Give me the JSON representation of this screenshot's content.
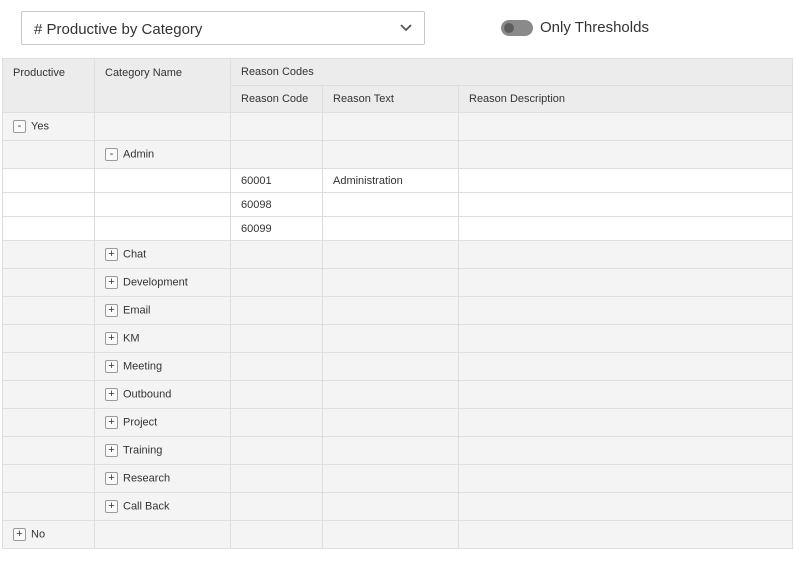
{
  "header": {
    "select_value": "# Productive by Category",
    "toggle_label": "Only Thresholds",
    "toggle_on": false
  },
  "table": {
    "columns": {
      "productive": "Productive",
      "category_name": "Category Name",
      "reason_codes_group": "Reason Codes",
      "reason_code": "Reason Code",
      "reason_text": "Reason Text",
      "reason_description": "Reason Description"
    },
    "rows": {
      "yes": {
        "toggle": "-",
        "label": "Yes"
      },
      "admin": {
        "toggle": "-",
        "label": "Admin"
      },
      "code1": {
        "code": "60001",
        "text": "Administration",
        "desc": ""
      },
      "code2": {
        "code": "60098",
        "text": "",
        "desc": ""
      },
      "code3": {
        "code": "60099",
        "text": "",
        "desc": ""
      },
      "chat": {
        "toggle": "+",
        "label": "Chat"
      },
      "development": {
        "toggle": "+",
        "label": "Development"
      },
      "email": {
        "toggle": "+",
        "label": "Email"
      },
      "km": {
        "toggle": "+",
        "label": "KM"
      },
      "meeting": {
        "toggle": "+",
        "label": "Meeting"
      },
      "outbound": {
        "toggle": "+",
        "label": "Outbound"
      },
      "project": {
        "toggle": "+",
        "label": "Project"
      },
      "training": {
        "toggle": "+",
        "label": "Training"
      },
      "research": {
        "toggle": "+",
        "label": "Research"
      },
      "callback": {
        "toggle": "+",
        "label": "Call Back"
      },
      "no": {
        "toggle": "+",
        "label": "No"
      }
    }
  },
  "icons": {
    "select_chevron": "chevron-down-icon"
  }
}
